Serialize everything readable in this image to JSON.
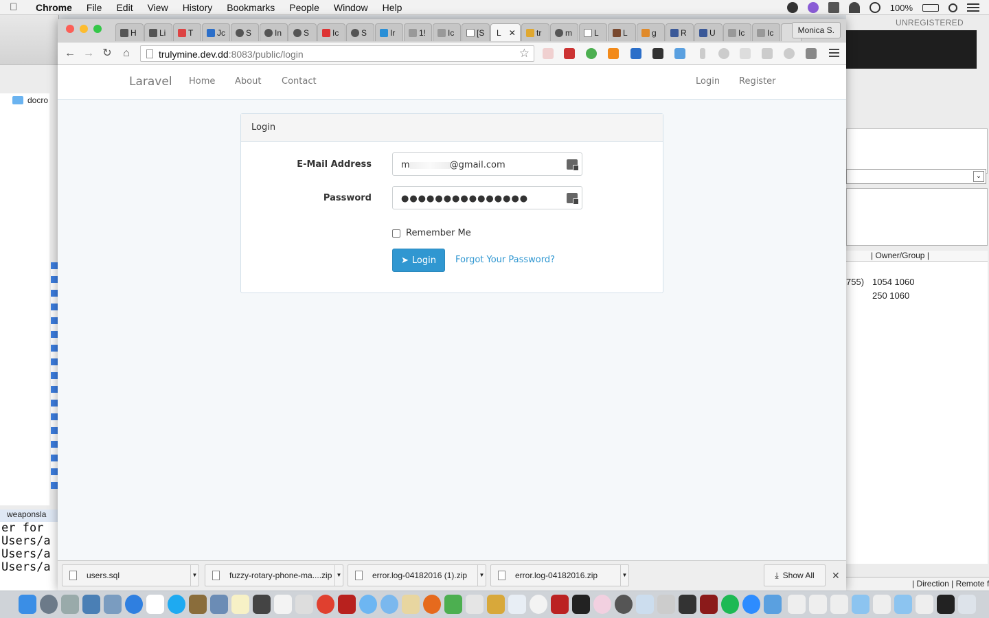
{
  "menubar": {
    "app": "Chrome",
    "items": [
      "File",
      "Edit",
      "View",
      "History",
      "Bookmarks",
      "People",
      "Window",
      "Help"
    ],
    "battery": "100%"
  },
  "background_left": {
    "folder": "docro",
    "file_label": "weaponsla",
    "terminal_lines": [
      "er for",
      "Users/a",
      "Users/a",
      "Users/a"
    ]
  },
  "background_right": {
    "banner": "UNREGISTERED",
    "column_header": "| Owner/Group |",
    "rows": [
      {
        "mode": "755)",
        "owner": "1054 1060"
      },
      {
        "mode": "",
        "owner": "250 1060"
      }
    ],
    "footer": "| Direction  | Remote f"
  },
  "browser": {
    "profile": "Monica S.",
    "tabs": [
      "H",
      "Li",
      "T",
      "Jc",
      "S",
      "In",
      "S",
      "Ic",
      "S",
      "Ir",
      "1!",
      "Ic",
      "[S",
      "L",
      "tr",
      "m",
      "L",
      "L",
      "g",
      "R",
      "U",
      "Ic",
      "Ic"
    ],
    "active_tab_label": "L",
    "url_host": "trulymine.dev.dd",
    "url_path": ":8083/public/login"
  },
  "site": {
    "brand": "Laravel",
    "nav": [
      "Home",
      "About",
      "Contact"
    ],
    "nav_right": [
      "Login",
      "Register"
    ],
    "panel_title": "Login",
    "email_label": "E-Mail Address",
    "email_prefix": "m",
    "email_suffix": "@gmail.com",
    "password_label": "Password",
    "password_mask": "●●●●●●●●●●●●●●●",
    "remember_label": "Remember Me",
    "login_button": "Login",
    "forgot_link": "Forgot Your Password?"
  },
  "downloads": {
    "items": [
      "users.sql",
      "fuzzy-rotary-phone-ma....zip",
      "error.log-04182016 (1).zip",
      "error.log-04182016.zip"
    ],
    "show_all": "Show All"
  },
  "colors": {
    "primary": "#3097d1",
    "close": "#fc5f57",
    "minimize": "#fdbc2e",
    "zoom": "#34c748"
  }
}
